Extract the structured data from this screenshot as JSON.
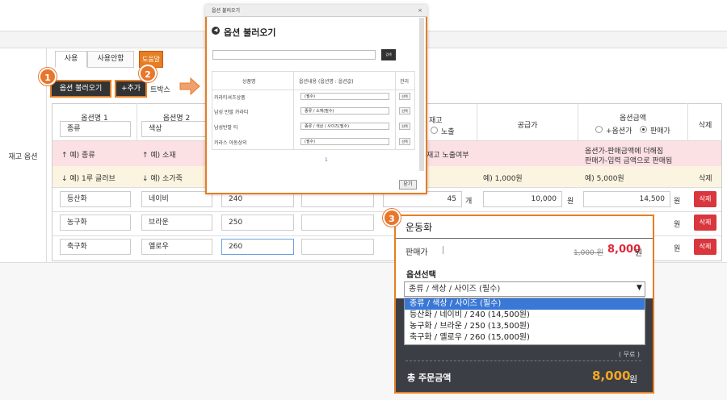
{
  "section_label": "재고 옵션",
  "tabs": {
    "use": "사용",
    "unused": "사용안함",
    "help": "도움말"
  },
  "buttons": {
    "load_option": "옵션 불러오기",
    "add": "+추가"
  },
  "partial_text": "트박스",
  "badges": [
    "1",
    "2",
    "3"
  ],
  "table": {
    "col_option1": "옵션명 1",
    "col_option2": "옵션명 2",
    "col_stock_partial": "재고",
    "expose": "노출",
    "col_supply": "공급가",
    "col_option_amount": "옵션금액",
    "radio_plus": "+옵션가",
    "radio_sale": "판매가",
    "col_delete": "삭제",
    "header_inputs": {
      "opt1": "종류",
      "opt2": "색상"
    },
    "example_pink": {
      "opt1": "↑ 예) 종류",
      "opt2": "↑ 예) 소재",
      "stock": "재고 노출여부",
      "amount_line1": "옵션가-판매금액에 더해짐",
      "amount_line2": "판매가-입력 금액으로 판매됨"
    },
    "example_beige": {
      "opt1": "↓ 예) 1루 글러브",
      "opt2": "↓ 예) 소가죽",
      "supply": "예) 1,000원",
      "amount": "예) 5,000원",
      "delete": "삭제"
    },
    "rows": [
      {
        "opt1": "등산화",
        "opt2": "네이비",
        "opt3": "240",
        "stock": "45",
        "unit": "개",
        "supply": "10,000",
        "won": "원",
        "amount": "14,500",
        "won2": "원",
        "delete": "삭제"
      },
      {
        "opt1": "농구화",
        "opt2": "브라운",
        "opt3": "250",
        "stock": "",
        "unit": "",
        "supply": "",
        "won": "",
        "amount": "",
        "won2": "원",
        "delete": "삭제"
      },
      {
        "opt1": "축구화",
        "opt2": "옐로우",
        "opt3": "260",
        "stock": "",
        "unit": "",
        "supply": "",
        "won": "",
        "amount": "",
        "won2": "원",
        "delete": "삭제"
      }
    ]
  },
  "modal": {
    "window_title": "옵션 불러오기",
    "heading": "옵션 불러오기",
    "search_button": "검색",
    "columns": {
      "name": "상품명",
      "content": "옵션내용 (옵션명 : 옵션값)",
      "manage": "관리"
    },
    "rows": [
      {
        "name": "카라티셔츠상품",
        "content": "(필수)",
        "pick": "선택"
      },
      {
        "name": "남성 반팔 카라티",
        "content": "종류 / 소재(필수)",
        "pick": "선택"
      },
      {
        "name": "남성반팔 티",
        "content": "종류 / 색상 / 사이즈(필수)",
        "pick": "선택"
      },
      {
        "name": "카라스 아동상의",
        "content": "(필수)",
        "pick": "선택"
      }
    ],
    "page": "1",
    "close": "닫기"
  },
  "product": {
    "name": "운동화",
    "price_label": "판매가",
    "original_price": "1,000 원",
    "sale_price": "8,000",
    "won": "원",
    "option_label": "옵션선택",
    "dropdown_value": "종류 / 색상 / 사이즈 (필수)",
    "dropdown_options": [
      "종류 / 색상 / 사이즈 (필수)",
      "등산화 / 네이비 / 240 (14,500원)",
      "농구화 / 브라운 / 250 (13,500원)",
      "축구화 / 옐로우 / 260 (15,000원)"
    ],
    "shipping": "( 무료 )",
    "total_label": "총 주문금액",
    "total_value": "8,000",
    "total_won": "원"
  },
  "colors": {
    "accent": "#e8772e",
    "delete": "#d9363e",
    "sale": "#e0283a",
    "total": "#f5a623",
    "dark_panel": "#3b3f45"
  }
}
